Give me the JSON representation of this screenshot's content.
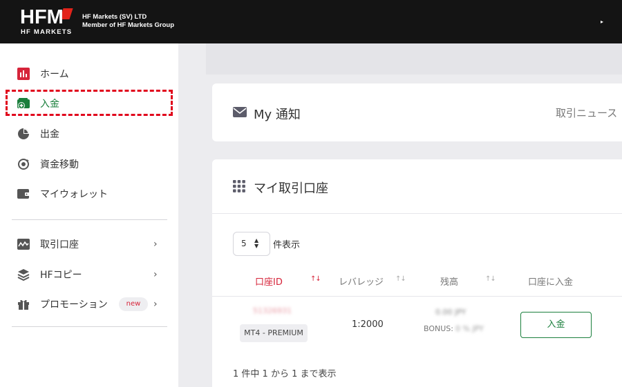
{
  "header": {
    "logo_text": "HFM",
    "logo_sub": "HF MARKETS",
    "company_line1": "HF Markets (SV) LTD",
    "company_line2": "Member of HF Markets Group"
  },
  "sidebar": {
    "items": [
      {
        "label": "ホーム",
        "icon": "bar-chart-icon"
      },
      {
        "label": "入金",
        "icon": "wallet-plus-icon"
      },
      {
        "label": "出金",
        "icon": "pie-icon"
      },
      {
        "label": "資金移動",
        "icon": "transfer-icon"
      },
      {
        "label": "マイウォレット",
        "icon": "wallet-icon"
      },
      {
        "label": "取引口座",
        "icon": "chart-line-icon"
      },
      {
        "label": "HFコピー",
        "icon": "layers-icon"
      },
      {
        "label": "プロモーション",
        "icon": "gift-icon",
        "badge": "new"
      }
    ]
  },
  "notifications": {
    "title": "My 通知",
    "right_label": "取引ニュース"
  },
  "accounts": {
    "title": "マイ取引口座",
    "page_size": "5",
    "page_size_label": "件表示",
    "columns": [
      "口座ID",
      "レバレッジ",
      "残高",
      "口座に入金"
    ],
    "rows": [
      {
        "account_id": "51326931",
        "account_type": "MT4 - PREMIUM",
        "leverage": "1:2000",
        "balance": "0.00 JPY",
        "bonus_label": "BONUS:",
        "bonus_value": "0 % JPY",
        "deposit_label": "入金"
      }
    ],
    "footer": "1 件中 1 から 1 まで表示"
  },
  "colors": {
    "header_bg": "#141414",
    "brand_red": "#e2231a",
    "active_green": "#1a7f3c",
    "highlight_red": "#e0001b"
  }
}
